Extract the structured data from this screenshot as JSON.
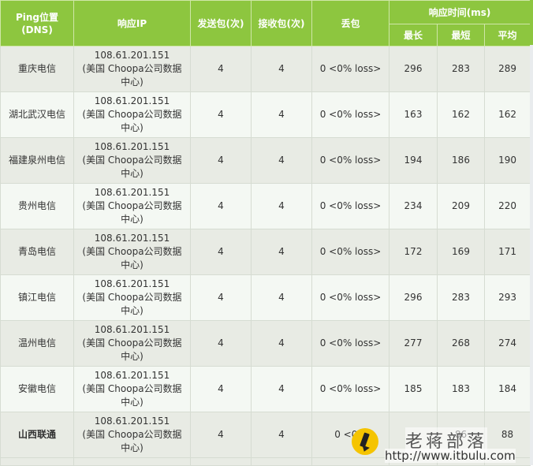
{
  "header": {
    "location": "Ping位置\n(DNS)",
    "ip": "响应IP",
    "sent": "发送包(次)",
    "received": "接收包(次)",
    "loss": "丢包",
    "response_time": "响应时间(ms)",
    "max": "最长",
    "min": "最短",
    "avg": "平均"
  },
  "rows": [
    {
      "location": "重庆电信",
      "ip": "108.61.201.151\n(美国 Choopa公司数据中心)",
      "sent": "4",
      "received": "4",
      "loss": "0 <0% loss>",
      "max": "296",
      "min": "283",
      "avg": "289"
    },
    {
      "location": "湖北武汉电信",
      "ip": "108.61.201.151\n(美国 Choopa公司数据中心)",
      "sent": "4",
      "received": "4",
      "loss": "0 <0% loss>",
      "max": "163",
      "min": "162",
      "avg": "162"
    },
    {
      "location": "福建泉州电信",
      "ip": "108.61.201.151\n(美国 Choopa公司数据中心)",
      "sent": "4",
      "received": "4",
      "loss": "0 <0% loss>",
      "max": "194",
      "min": "186",
      "avg": "190"
    },
    {
      "location": "贵州电信",
      "ip": "108.61.201.151\n(美国 Choopa公司数据中心)",
      "sent": "4",
      "received": "4",
      "loss": "0 <0% loss>",
      "max": "234",
      "min": "209",
      "avg": "220"
    },
    {
      "location": "青岛电信",
      "ip": "108.61.201.151\n(美国 Choopa公司数据中心)",
      "sent": "4",
      "received": "4",
      "loss": "0 <0% loss>",
      "max": "172",
      "min": "169",
      "avg": "171"
    },
    {
      "location": "镇江电信",
      "ip": "108.61.201.151\n(美国 Choopa公司数据中心)",
      "sent": "4",
      "received": "4",
      "loss": "0 <0% loss>",
      "max": "296",
      "min": "283",
      "avg": "293"
    },
    {
      "location": "温州电信",
      "ip": "108.61.201.151\n(美国 Choopa公司数据中心)",
      "sent": "4",
      "received": "4",
      "loss": "0 <0% loss>",
      "max": "277",
      "min": "268",
      "avg": "274"
    },
    {
      "location": "安徽电信",
      "ip": "108.61.201.151\n(美国 Choopa公司数据中心)",
      "sent": "4",
      "received": "4",
      "loss": "0 <0% loss>",
      "max": "185",
      "min": "183",
      "avg": "184"
    },
    {
      "location": "山西联通",
      "ip": "108.61.201.151\n(美国 Choopa公司数据中心)",
      "sent": "4",
      "received": "4",
      "loss": "0 <0%",
      "max": "",
      "min": "86",
      "avg": "88",
      "bold": true
    }
  ],
  "watermark": {
    "title": "老蒋部落",
    "url": "http://www.itbulu.com"
  },
  "colors": {
    "header_green": "#8dc63f",
    "row_odd": "#e8ebe4",
    "row_even": "#f4f8f3"
  }
}
